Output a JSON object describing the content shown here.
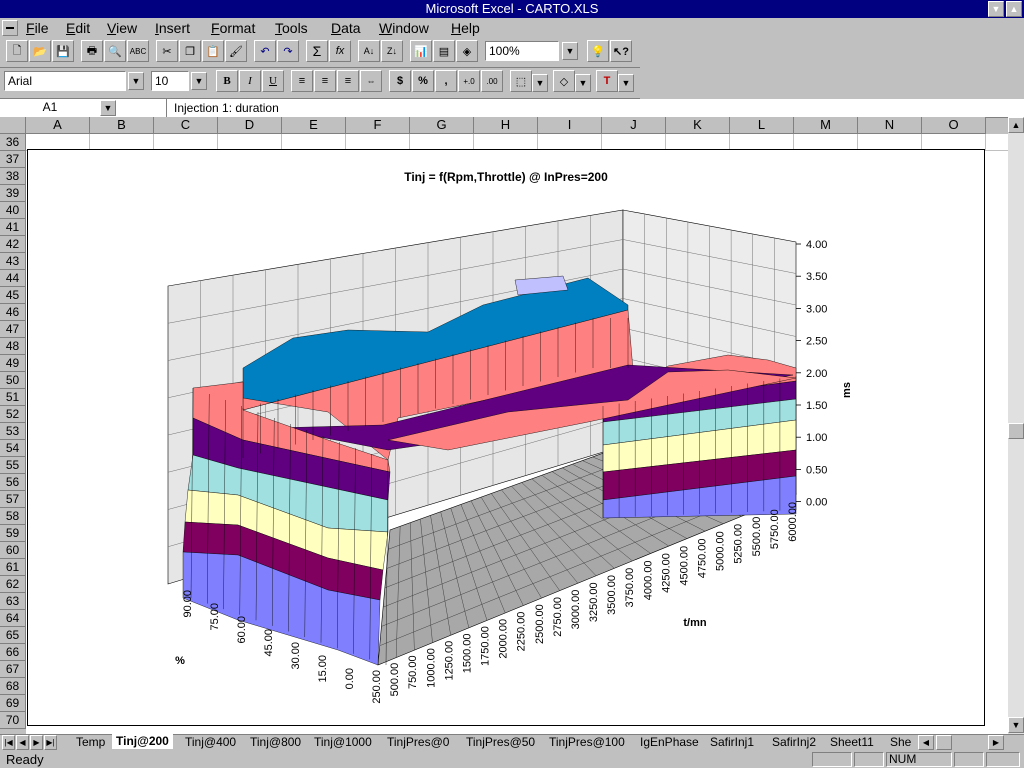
{
  "window": {
    "title": "Microsoft Excel - CARTO.XLS"
  },
  "menu": [
    "File",
    "Edit",
    "View",
    "Insert",
    "Format",
    "Tools",
    "Data",
    "Window",
    "Help"
  ],
  "toolbar": {
    "zoom": "100%",
    "font_name": "Arial",
    "font_size": "10"
  },
  "formula_bar": {
    "name_box": "A1",
    "content": "Injection 1: duration"
  },
  "columns": [
    "A",
    "B",
    "C",
    "D",
    "E",
    "F",
    "G",
    "H",
    "I",
    "J",
    "K",
    "L",
    "M",
    "N",
    "O"
  ],
  "rows": [
    "36",
    "37",
    "38",
    "39",
    "40",
    "41",
    "42",
    "43",
    "44",
    "45",
    "46",
    "47",
    "48",
    "49",
    "50",
    "51",
    "52",
    "53",
    "54",
    "55",
    "56",
    "57",
    "58",
    "59",
    "60",
    "61",
    "62",
    "63",
    "64",
    "65",
    "66",
    "67",
    "68",
    "69",
    "70"
  ],
  "tabs": [
    "Temp",
    "Tinj@200",
    "Tinj@400",
    "Tinj@800",
    "Tinj@1000",
    "TinjPres@0",
    "TinjPres@50",
    "TinjPres@100",
    "IgEnPhase",
    "SafirInj1",
    "SafirInj2",
    "Sheet11",
    "She"
  ],
  "active_tab": "Tinj@200",
  "status": {
    "left": "Ready",
    "num": "NUM"
  },
  "colors": {
    "title_bar": "#000080",
    "band_colors": [
      "#8080ff",
      "#800060",
      "#ffffc0",
      "#a0e0e0",
      "#600080",
      "#ff8080",
      "#0080c0",
      "#c0c0ff"
    ]
  },
  "chart_data": {
    "type": "surface",
    "title": "Tinj = f(Rpm,Throttle) @ InPres=200",
    "z_label": "ms",
    "x_label": "t/mn",
    "y_label": "%",
    "z_ticks": [
      "4.00",
      "3.50",
      "3.00",
      "2.50",
      "2.00",
      "1.50",
      "1.00",
      "0.50",
      "0.00"
    ],
    "z_range": [
      0,
      4
    ],
    "x_ticks": [
      "250.00",
      "500.00",
      "750.00",
      "1000.00",
      "1250.00",
      "1500.00",
      "1750.00",
      "2000.00",
      "2250.00",
      "2500.00",
      "2750.00",
      "3000.00",
      "3250.00",
      "3500.00",
      "3750.00",
      "4000.00",
      "4250.00",
      "4500.00",
      "4750.00",
      "5000.00",
      "5250.00",
      "5500.00",
      "5750.00",
      "6000.00"
    ],
    "y_ticks": [
      "0.00",
      "15.00",
      "30.00",
      "45.00",
      "60.00",
      "75.00",
      "90.00"
    ],
    "grid": true
  }
}
